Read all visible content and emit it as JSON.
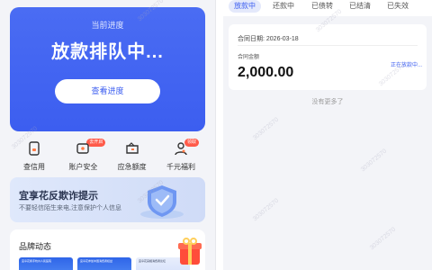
{
  "left": {
    "hero": {
      "label": "当前进度",
      "status": "放款排队中...",
      "button": "查看进度"
    },
    "quick": [
      {
        "label": "查信用",
        "icon": "credit-report-icon",
        "badge": ""
      },
      {
        "label": "账户安全",
        "icon": "account-security-icon",
        "badge": "去开启"
      },
      {
        "label": "应急额度",
        "icon": "wallet-icon",
        "badge": ""
      },
      {
        "label": "千元福利",
        "icon": "gift-user-icon",
        "badge": "领取"
      }
    ],
    "banner": {
      "title": "宜享花反欺诈提示",
      "subtitle": "不要轻信陌生来电,注意保护个人信息"
    },
    "brand": {
      "title": "品牌动态",
      "cards": [
        "宜享花携手杭州人民医院",
        "宜享花参加中国消费者权益",
        "宜享花亮相消费者论坛"
      ]
    }
  },
  "right": {
    "tabs": [
      "放款中",
      "还款中",
      "已债转",
      "已结清",
      "已失效"
    ],
    "active_tab": "放款中",
    "card": {
      "date": "合同日期: 2026-03-18",
      "amount_label": "合同金额",
      "amount": "2,000.00",
      "status": "正在放款中..."
    },
    "no_more": "没有更多了"
  },
  "watermark": "303072570",
  "colors": {
    "accent": "#3c5ef0",
    "badge": "#ff5b4a",
    "background": "#f3f4f8"
  }
}
